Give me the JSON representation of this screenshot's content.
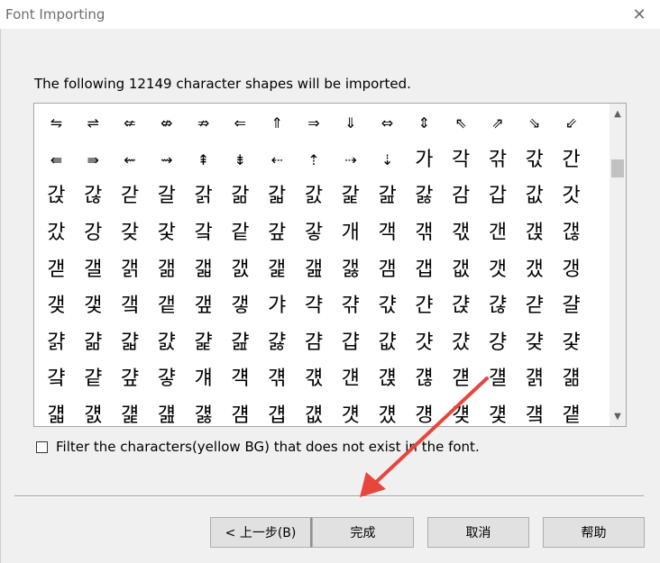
{
  "window": {
    "title": "Font Importing",
    "close_glyph": "✕"
  },
  "description": "The following 12149 character shapes will be imported.",
  "glyphs": [
    "⇋",
    "⇌",
    "⇍",
    "⇎",
    "⇏",
    "⇐",
    "⇑",
    "⇒",
    "⇓",
    "⇔",
    "⇕",
    "⇖",
    "⇗",
    "⇘",
    "⇙",
    "⇚",
    "⇛",
    "⇜",
    "⇝",
    "⇞",
    "⇟",
    "⇠",
    "⇡",
    "⇢",
    "⇣",
    "가",
    "각",
    "갂",
    "갃",
    "간",
    "갅",
    "갆",
    "갇",
    "갈",
    "갉",
    "갊",
    "갋",
    "갌",
    "갍",
    "갎",
    "갏",
    "감",
    "갑",
    "값",
    "갓",
    "갔",
    "강",
    "갖",
    "갗",
    "갘",
    "같",
    "갚",
    "갛",
    "개",
    "객",
    "갞",
    "갟",
    "갠",
    "갡",
    "갢",
    "갣",
    "갤",
    "갥",
    "갦",
    "갧",
    "갨",
    "갩",
    "갪",
    "갫",
    "갬",
    "갭",
    "갮",
    "갯",
    "갰",
    "갱",
    "갲",
    "갳",
    "갴",
    "갵",
    "갶",
    "갷",
    "갸",
    "갹",
    "갺",
    "갻",
    "갼",
    "갽",
    "갾",
    "갿",
    "걀",
    "걁",
    "걂",
    "걃",
    "걄",
    "걅",
    "걆",
    "걇",
    "걈",
    "걉",
    "걊",
    "걋",
    "걌",
    "걍",
    "걎",
    "걏",
    "걐",
    "걑",
    "걒",
    "걓",
    "걔",
    "걕",
    "걖",
    "걗",
    "걘",
    "걙",
    "걚",
    "걛",
    "걜",
    "걝",
    "걞",
    "걟",
    "걠",
    "걡",
    "걢",
    "걣",
    "걤",
    "걥",
    "걦",
    "걧",
    "걨",
    "걩",
    "걪",
    "걫",
    "걬",
    "걭"
  ],
  "scrollbar": {
    "up_glyph": "▲",
    "down_glyph": "▼"
  },
  "filter": {
    "label": "Filter the characters(yellow BG) that does not exist in the font.",
    "checked": false
  },
  "buttons": {
    "back": "< 上一步(B)",
    "finish": "完成",
    "cancel": "取消",
    "help": "帮助"
  },
  "colors": {
    "annotation_arrow": "#e8453c"
  }
}
